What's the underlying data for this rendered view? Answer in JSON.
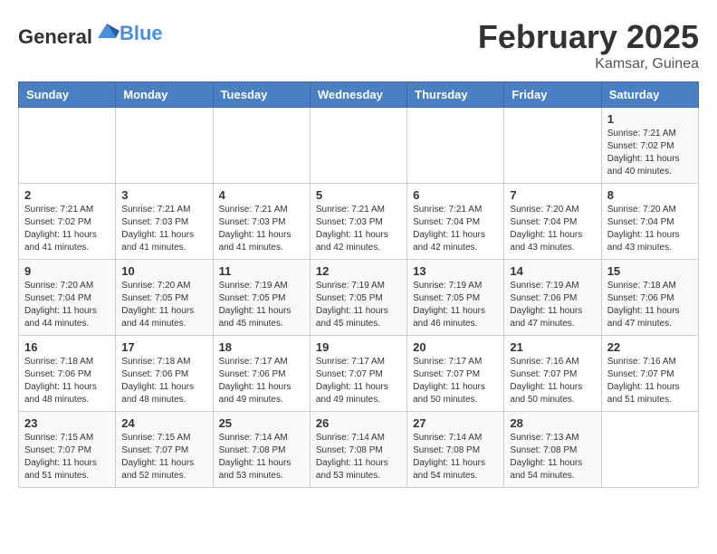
{
  "header": {
    "logo": {
      "general": "General",
      "blue": "Blue"
    },
    "month": "February 2025",
    "location": "Kamsar, Guinea"
  },
  "weekdays": [
    "Sunday",
    "Monday",
    "Tuesday",
    "Wednesday",
    "Thursday",
    "Friday",
    "Saturday"
  ],
  "weeks": [
    [
      {
        "day": "",
        "info": ""
      },
      {
        "day": "",
        "info": ""
      },
      {
        "day": "",
        "info": ""
      },
      {
        "day": "",
        "info": ""
      },
      {
        "day": "",
        "info": ""
      },
      {
        "day": "",
        "info": ""
      },
      {
        "day": "1",
        "info": "Sunrise: 7:21 AM\nSunset: 7:02 PM\nDaylight: 11 hours\nand 40 minutes."
      }
    ],
    [
      {
        "day": "2",
        "info": "Sunrise: 7:21 AM\nSunset: 7:02 PM\nDaylight: 11 hours\nand 41 minutes."
      },
      {
        "day": "3",
        "info": "Sunrise: 7:21 AM\nSunset: 7:03 PM\nDaylight: 11 hours\nand 41 minutes."
      },
      {
        "day": "4",
        "info": "Sunrise: 7:21 AM\nSunset: 7:03 PM\nDaylight: 11 hours\nand 41 minutes."
      },
      {
        "day": "5",
        "info": "Sunrise: 7:21 AM\nSunset: 7:03 PM\nDaylight: 11 hours\nand 42 minutes."
      },
      {
        "day": "6",
        "info": "Sunrise: 7:21 AM\nSunset: 7:04 PM\nDaylight: 11 hours\nand 42 minutes."
      },
      {
        "day": "7",
        "info": "Sunrise: 7:20 AM\nSunset: 7:04 PM\nDaylight: 11 hours\nand 43 minutes."
      },
      {
        "day": "8",
        "info": "Sunrise: 7:20 AM\nSunset: 7:04 PM\nDaylight: 11 hours\nand 43 minutes."
      }
    ],
    [
      {
        "day": "9",
        "info": "Sunrise: 7:20 AM\nSunset: 7:04 PM\nDaylight: 11 hours\nand 44 minutes."
      },
      {
        "day": "10",
        "info": "Sunrise: 7:20 AM\nSunset: 7:05 PM\nDaylight: 11 hours\nand 44 minutes."
      },
      {
        "day": "11",
        "info": "Sunrise: 7:19 AM\nSunset: 7:05 PM\nDaylight: 11 hours\nand 45 minutes."
      },
      {
        "day": "12",
        "info": "Sunrise: 7:19 AM\nSunset: 7:05 PM\nDaylight: 11 hours\nand 45 minutes."
      },
      {
        "day": "13",
        "info": "Sunrise: 7:19 AM\nSunset: 7:05 PM\nDaylight: 11 hours\nand 46 minutes."
      },
      {
        "day": "14",
        "info": "Sunrise: 7:19 AM\nSunset: 7:06 PM\nDaylight: 11 hours\nand 47 minutes."
      },
      {
        "day": "15",
        "info": "Sunrise: 7:18 AM\nSunset: 7:06 PM\nDaylight: 11 hours\nand 47 minutes."
      }
    ],
    [
      {
        "day": "16",
        "info": "Sunrise: 7:18 AM\nSunset: 7:06 PM\nDaylight: 11 hours\nand 48 minutes."
      },
      {
        "day": "17",
        "info": "Sunrise: 7:18 AM\nSunset: 7:06 PM\nDaylight: 11 hours\nand 48 minutes."
      },
      {
        "day": "18",
        "info": "Sunrise: 7:17 AM\nSunset: 7:06 PM\nDaylight: 11 hours\nand 49 minutes."
      },
      {
        "day": "19",
        "info": "Sunrise: 7:17 AM\nSunset: 7:07 PM\nDaylight: 11 hours\nand 49 minutes."
      },
      {
        "day": "20",
        "info": "Sunrise: 7:17 AM\nSunset: 7:07 PM\nDaylight: 11 hours\nand 50 minutes."
      },
      {
        "day": "21",
        "info": "Sunrise: 7:16 AM\nSunset: 7:07 PM\nDaylight: 11 hours\nand 50 minutes."
      },
      {
        "day": "22",
        "info": "Sunrise: 7:16 AM\nSunset: 7:07 PM\nDaylight: 11 hours\nand 51 minutes."
      }
    ],
    [
      {
        "day": "23",
        "info": "Sunrise: 7:15 AM\nSunset: 7:07 PM\nDaylight: 11 hours\nand 51 minutes."
      },
      {
        "day": "24",
        "info": "Sunrise: 7:15 AM\nSunset: 7:07 PM\nDaylight: 11 hours\nand 52 minutes."
      },
      {
        "day": "25",
        "info": "Sunrise: 7:14 AM\nSunset: 7:08 PM\nDaylight: 11 hours\nand 53 minutes."
      },
      {
        "day": "26",
        "info": "Sunrise: 7:14 AM\nSunset: 7:08 PM\nDaylight: 11 hours\nand 53 minutes."
      },
      {
        "day": "27",
        "info": "Sunrise: 7:14 AM\nSunset: 7:08 PM\nDaylight: 11 hours\nand 54 minutes."
      },
      {
        "day": "28",
        "info": "Sunrise: 7:13 AM\nSunset: 7:08 PM\nDaylight: 11 hours\nand 54 minutes."
      },
      {
        "day": "",
        "info": ""
      }
    ]
  ]
}
